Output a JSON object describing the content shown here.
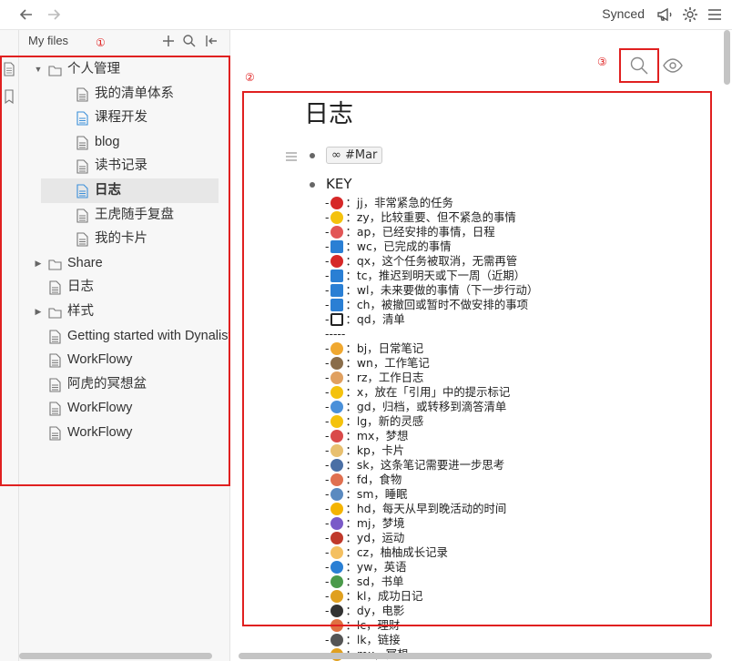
{
  "topbar": {
    "back_icon": "arrow-left-icon",
    "forward_icon": "arrow-right-icon",
    "status": "Synced",
    "icons": [
      "megaphone-icon",
      "gear-icon",
      "menu-icon"
    ]
  },
  "sidebar": {
    "title": "My files",
    "tools": [
      "plus-icon",
      "search-icon",
      "collapse-icon"
    ],
    "rail": [
      "document-icon",
      "bookmark-icon"
    ],
    "items": [
      {
        "label": "个人管理",
        "type": "folder",
        "depth": 0,
        "expanded": true
      },
      {
        "label": "我的清单体系",
        "type": "file",
        "depth": 1
      },
      {
        "label": "课程开发",
        "type": "file-blue",
        "depth": 1
      },
      {
        "label": "blog",
        "type": "file",
        "depth": 1
      },
      {
        "label": "读书记录",
        "type": "file",
        "depth": 1
      },
      {
        "label": "日志",
        "type": "file-blue",
        "depth": 1,
        "active": true
      },
      {
        "label": "王虎随手复盘",
        "type": "file",
        "depth": 1
      },
      {
        "label": "我的卡片",
        "type": "file",
        "depth": 1
      },
      {
        "label": "Share",
        "type": "folder",
        "depth": 0,
        "expanded": false
      },
      {
        "label": "日志",
        "type": "file",
        "depth": 0
      },
      {
        "label": "样式",
        "type": "folder",
        "depth": 0,
        "expanded": false
      },
      {
        "label": "Getting started with Dynalist",
        "type": "file",
        "depth": 0
      },
      {
        "label": "WorkFlowy",
        "type": "file",
        "depth": 0
      },
      {
        "label": "阿虎的冥想盆",
        "type": "file",
        "depth": 0
      },
      {
        "label": "WorkFlowy",
        "type": "file",
        "depth": 0
      },
      {
        "label": "WorkFlowy",
        "type": "file",
        "depth": 0
      }
    ]
  },
  "annotations": {
    "marker_1": "①",
    "marker_2": "②",
    "marker_3": "③",
    "color": "#e02020"
  },
  "document": {
    "title": "日志",
    "tag_item": "∞ #Mar",
    "key_title": "KEY",
    "key_lines": [
      {
        "emoji": "exclamation",
        "color": "#d62828",
        "text": "：jj，非常紧急的任务"
      },
      {
        "emoji": "star",
        "color": "#f4c20d",
        "text": "：zy，比较重要、但不紧急的事情"
      },
      {
        "emoji": "calendar",
        "color": "#e25656",
        "text": "：ap，已经安排的事情，日程"
      },
      {
        "emoji": "check",
        "color": "#2a7fd4",
        "text": "：wc，已完成的事情"
      },
      {
        "emoji": "prohibited",
        "color": "#d62828",
        "text": "：qx，这个任务被取消，无需再管"
      },
      {
        "emoji": "soon-arrow",
        "color": "#2a7fd4",
        "text": "：tc，推迟到明天或下一周（近期）"
      },
      {
        "emoji": "right-arrow",
        "color": "#2a7fd4",
        "text": "：wl，未来要做的事情（下一步行动）"
      },
      {
        "emoji": "left-arrow",
        "color": "#2a7fd4",
        "text": "：ch，被撤回或暂时不做安排的事项"
      },
      {
        "emoji": "square",
        "color": "#222222",
        "text": "：qd，清单"
      },
      {
        "emoji": "",
        "color": "",
        "text": "-----"
      },
      {
        "emoji": "pencil",
        "color": "#f0a830",
        "text": "：bj，日常笔记"
      },
      {
        "emoji": "notebook",
        "color": "#8a6d4a",
        "text": "：wn，工作笔记"
      },
      {
        "emoji": "phone",
        "color": "#e0a060",
        "text": "：rz，工作日志"
      },
      {
        "emoji": "thinking-face",
        "color": "#f4c20d",
        "text": "：x，放在「引用」中的提示标记"
      },
      {
        "emoji": "inbox-tray",
        "color": "#4a90d9",
        "text": "：gd，归档，或转移到滴答清单"
      },
      {
        "emoji": "light-bulb",
        "color": "#f4c20d",
        "text": "：lg，新的灵感"
      },
      {
        "emoji": "envelope",
        "color": "#d94a4a",
        "text": "：mx，梦想"
      },
      {
        "emoji": "memo",
        "color": "#e8c070",
        "text": "：kp，卡片"
      },
      {
        "emoji": "magnifier",
        "color": "#4a6fa5",
        "text": "：sk，这条笔记需要进一步思考"
      },
      {
        "emoji": "bowl",
        "color": "#e07050",
        "text": "：fd，食物"
      },
      {
        "emoji": "bed",
        "color": "#5a8ac0",
        "text": "：sm，睡眠"
      },
      {
        "emoji": "sun",
        "color": "#f4b400",
        "text": "：hd，每天从早到晚活动的时间"
      },
      {
        "emoji": "crystal-ball",
        "color": "#7a5ac8",
        "text": "：mj，梦境"
      },
      {
        "emoji": "runner",
        "color": "#c0392b",
        "text": "：yd，运动"
      },
      {
        "emoji": "baby",
        "color": "#f4c060",
        "text": "：cz，柚柚成长记录"
      },
      {
        "emoji": "abc",
        "color": "#2a7fd4",
        "text": "：yw，英语"
      },
      {
        "emoji": "books",
        "color": "#4a9a4a",
        "text": "：sd，书单"
      },
      {
        "emoji": "party-popper",
        "color": "#e0a020",
        "text": "：kl，成功日记"
      },
      {
        "emoji": "clapper",
        "color": "#333333",
        "text": "：dy，电影"
      },
      {
        "emoji": "ledger",
        "color": "#e07040",
        "text": "：lc，理财"
      },
      {
        "emoji": "link",
        "color": "#555555",
        "text": "：lk，链接"
      },
      {
        "emoji": "person",
        "color": "#e0a020",
        "text": "：mx，冥想"
      }
    ]
  },
  "main_tools": [
    "search-icon",
    "eye-icon"
  ]
}
